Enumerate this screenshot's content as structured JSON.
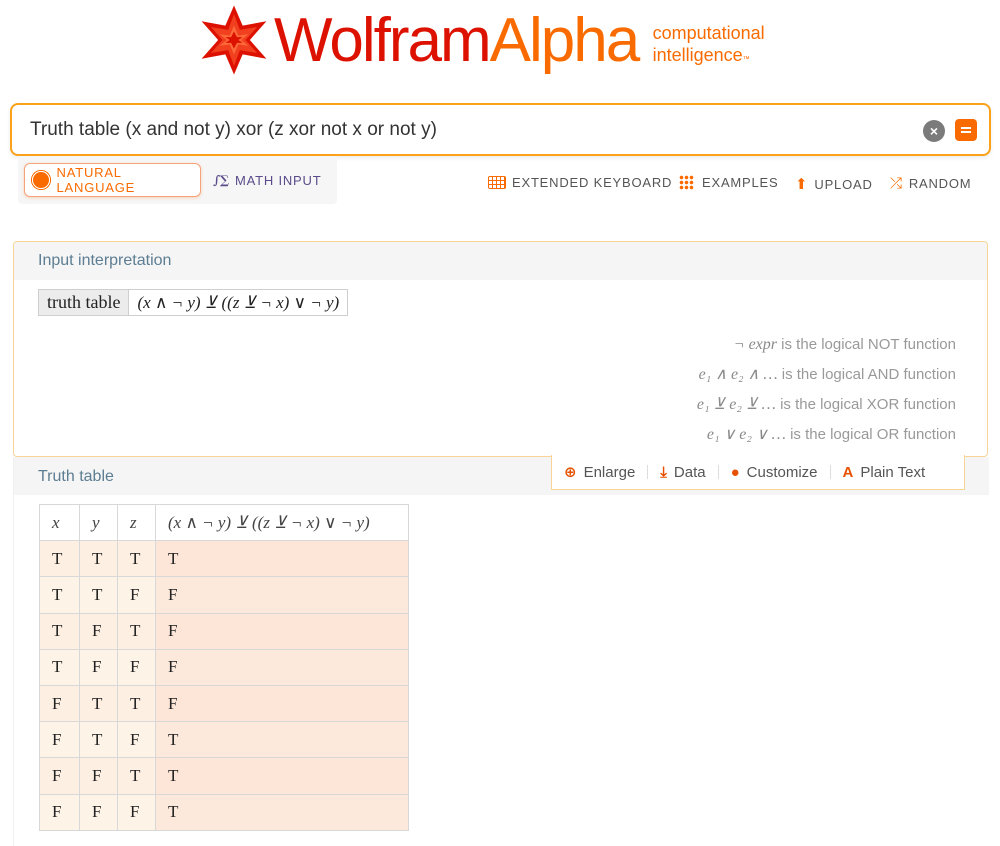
{
  "logo": {
    "word_part1": "Wolfram",
    "word_part2": "Alpha",
    "registered": "®",
    "tagline_line1": "computational",
    "tagline_line2": "intelligence",
    "tagline_tm": "™",
    "colors": {
      "red": "#dd1100",
      "orange": "#f96b00"
    }
  },
  "search": {
    "query": "Truth table (x and not y) xor (z xor not x or not y)",
    "clear_icon": "clear-icon",
    "submit_icon": "equals-icon"
  },
  "modes": {
    "natural_language": "NATURAL LANGUAGE",
    "math_input": "MATH INPUT",
    "math_icon_text": "∫∑"
  },
  "toolbar": {
    "extended_keyboard": "EXTENDED KEYBOARD",
    "examples": "EXAMPLES",
    "upload": "UPLOAD",
    "random": "RANDOM"
  },
  "interpretation": {
    "title": "Input interpretation",
    "label": "truth table",
    "expression": "(x ∧ ¬ y) ⊻ ((z ⊻ ¬ x) ∨ ¬ y)",
    "notes": [
      {
        "math": "¬ expr",
        "text": " is the logical NOT function"
      },
      {
        "math": "e₁ ∧ e₂ ∧ …",
        "text": " is the logical AND function"
      },
      {
        "math": "e₁ ⊻ e₂ ⊻ …",
        "text": " is the logical XOR function"
      },
      {
        "math": "e₁ ∨ e₂ ∨ …",
        "text": " is the logical OR function"
      }
    ]
  },
  "truth_table": {
    "title": "Truth table",
    "actions": {
      "enlarge": "Enlarge",
      "data": "Data",
      "customize": "Customize",
      "plain_text": "Plain Text"
    },
    "headers": [
      "x",
      "y",
      "z",
      "(x ∧ ¬ y) ⊻ ((z ⊻ ¬ x) ∨ ¬ y)"
    ],
    "rows": [
      [
        "T",
        "T",
        "T",
        "T"
      ],
      [
        "T",
        "T",
        "F",
        "F"
      ],
      [
        "T",
        "F",
        "T",
        "F"
      ],
      [
        "T",
        "F",
        "F",
        "F"
      ],
      [
        "F",
        "T",
        "T",
        "F"
      ],
      [
        "F",
        "T",
        "F",
        "T"
      ],
      [
        "F",
        "F",
        "T",
        "T"
      ],
      [
        "F",
        "F",
        "F",
        "T"
      ]
    ]
  }
}
